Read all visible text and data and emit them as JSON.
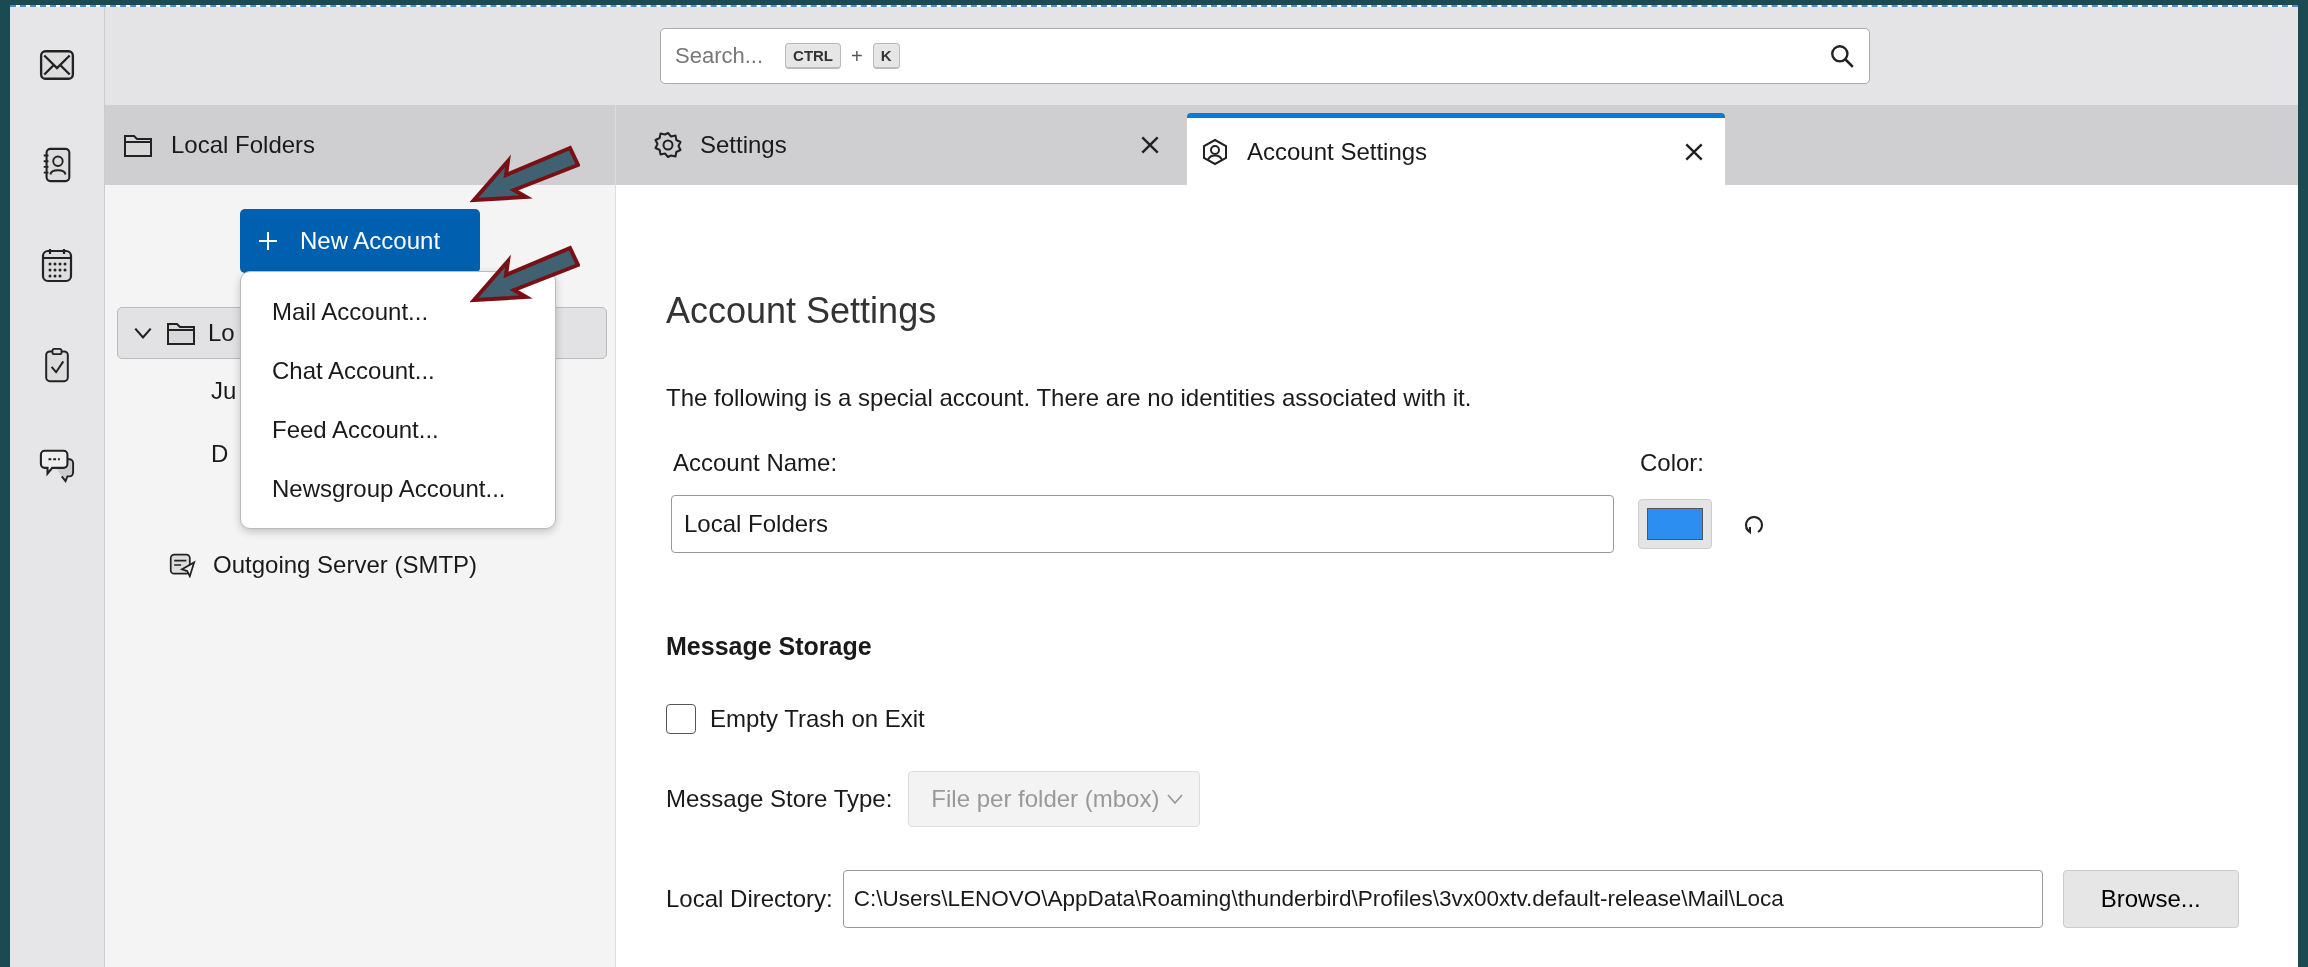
{
  "search": {
    "placeholder": "Search...",
    "keys": [
      "CTRL",
      "K"
    ],
    "joiner": "+"
  },
  "folder_pane": {
    "header": "Local Folders",
    "new_account_button": "New Account",
    "tree": [
      {
        "label": "Lo",
        "kind": "folder",
        "expanded": true,
        "selected": true,
        "children": [
          {
            "label": "Ju"
          },
          {
            "label": "D"
          }
        ]
      },
      {
        "label": "Outgoing Server (SMTP)",
        "kind": "server"
      }
    ]
  },
  "menu": [
    {
      "label": "Mail Account..."
    },
    {
      "label": "Chat Account..."
    },
    {
      "label": "Feed Account..."
    },
    {
      "label": "Newsgroup Account..."
    }
  ],
  "tabs": [
    {
      "label": "Settings",
      "kind": "settings",
      "selected": false
    },
    {
      "label": "Account Settings",
      "kind": "account",
      "selected": true
    }
  ],
  "content": {
    "title": "Account Settings",
    "note": "The following is a special account. There are no identities associated with it.",
    "account_name": {
      "label": "Account Name:",
      "value": "Local Folders"
    },
    "color": {
      "label": "Color:"
    },
    "storage_heading": "Message Storage",
    "empty_trash": {
      "label": "Empty Trash on Exit",
      "checked": false
    },
    "store_type": {
      "label": "Message Store Type:",
      "value": "File per folder (mbox)",
      "disabled": true
    },
    "directory": {
      "label": "Local Directory:",
      "value": "C:\\Users\\LENOVO\\AppData\\Roaming\\thunderbird\\Profiles\\3vx00xtv.default-release\\Mail\\Loca",
      "button": "Browse..."
    }
  }
}
